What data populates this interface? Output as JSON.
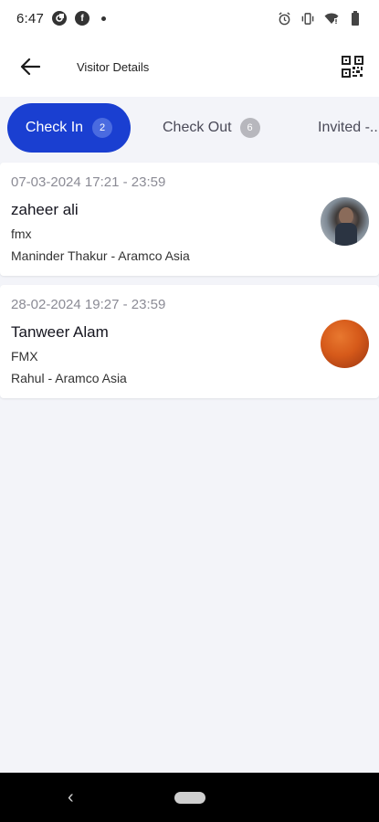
{
  "status_bar": {
    "time": "6:47",
    "icons": [
      "app-notification-icon",
      "facebook-icon",
      "dot-icon",
      "alarm-icon",
      "vibrate-icon",
      "wifi-icon",
      "battery-icon"
    ]
  },
  "app_bar": {
    "title": "Visitor Details",
    "back_icon": "arrow-left-icon",
    "action_icon": "qr-code-icon"
  },
  "tabs": [
    {
      "label": "Check In",
      "count": "2",
      "active": true
    },
    {
      "label": "Check Out",
      "count": "6",
      "active": false
    },
    {
      "label": "Invited -...",
      "active": false
    }
  ],
  "visitors": [
    {
      "time_range": "07-03-2024 17:21 - 23:59",
      "name": "zaheer ali",
      "company": "fmx",
      "host": "Maninder Thakur - Aramco Asia",
      "avatar": "photo"
    },
    {
      "time_range": "28-02-2024 19:27 - 23:59",
      "name": "Tanweer Alam",
      "company": "FMX",
      "host": "Rahul - Aramco Asia",
      "avatar": "orange-circle"
    }
  ],
  "colors": {
    "accent": "#1a3fd1",
    "background": "#f3f4f9",
    "card": "#ffffff"
  },
  "nav_bar": {
    "back": "‹"
  }
}
